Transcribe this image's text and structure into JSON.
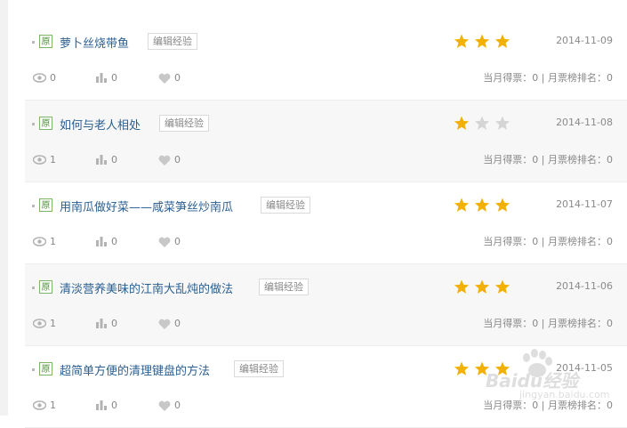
{
  "articles": [
    {
      "badge": "原",
      "title": "萝卜丝烧带鱼",
      "edit_label": "编辑经验",
      "stars": 3,
      "date": "2014-11-09",
      "views": "0",
      "votes_count": "0",
      "likes": "0",
      "votes_text": "当月得票：0 | 月票榜排名：0"
    },
    {
      "badge": "原",
      "title": "如何与老人相处",
      "edit_label": "编辑经验",
      "stars": 1,
      "date": "2014-11-08",
      "views": "1",
      "votes_count": "0",
      "likes": "0",
      "votes_text": "当月得票：0 | 月票榜排名：0"
    },
    {
      "badge": "原",
      "title": "用南瓜做好菜——咸菜笋丝炒南瓜",
      "edit_label": "编辑经验",
      "stars": 3,
      "date": "2014-11-07",
      "views": "1",
      "votes_count": "0",
      "likes": "0",
      "votes_text": "当月得票：0 | 月票榜排名：0"
    },
    {
      "badge": "原",
      "title": "清淡营养美味的江南大乱炖的做法",
      "edit_label": "编辑经验",
      "stars": 3,
      "date": "2014-11-06",
      "views": "1",
      "votes_count": "0",
      "likes": "0",
      "votes_text": "当月得票：0 | 月票榜排名：0"
    },
    {
      "badge": "原",
      "title": "超简单方便的清理键盘的方法",
      "edit_label": "编辑经验",
      "stars": 3,
      "date": "2014-11-05",
      "views": "1",
      "votes_count": "0",
      "likes": "0",
      "votes_text": "当月得票：0 | 月票榜排名：0"
    }
  ],
  "colors": {
    "star_on": "#f2b100",
    "star_off": "#d5d5d5",
    "link": "#2b5f91"
  },
  "icons": {
    "views": "eye-icon",
    "votes": "bar-chart-icon",
    "likes": "heart-icon",
    "rating": "star-icon"
  },
  "watermark": {
    "text": "Baidu经验",
    "sub": "jingyan.baidu.com"
  }
}
